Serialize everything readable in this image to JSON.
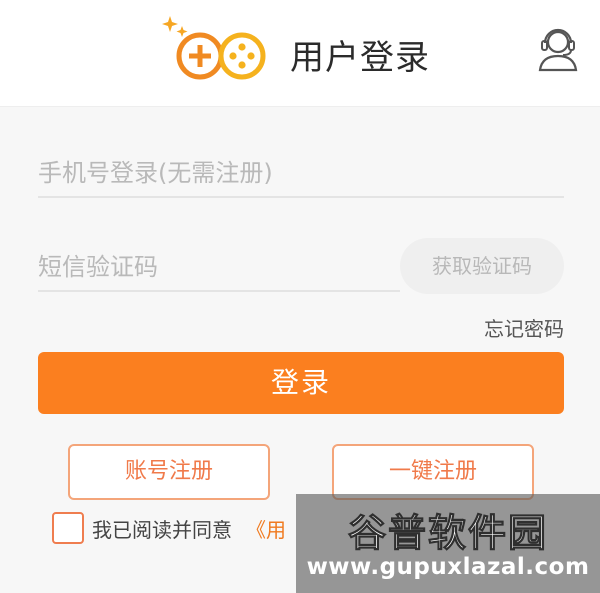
{
  "header": {
    "title": "用户登录",
    "logo_icon": "gamepad-logo-icon",
    "support_icon": "customer-service-icon"
  },
  "form": {
    "phone_placeholder": "手机号登录(无需注册)",
    "phone_value": "",
    "sms_placeholder": "短信验证码",
    "sms_value": "",
    "get_code_label": "获取验证码",
    "forgot_password_label": "忘记密码",
    "login_label": "登录",
    "account_register_label": "账号注册",
    "quick_register_label": "一键注册",
    "agree_text": "我已阅读并同意",
    "agreement_link_text": "《用",
    "agree_checked": false
  },
  "colors": {
    "accent": "#fb7f1f",
    "outline": "#f4a57a",
    "logo_orange": "#f08a22"
  },
  "watermark": {
    "title": "谷普软件园",
    "url": "www.gupuxlazal.com"
  }
}
